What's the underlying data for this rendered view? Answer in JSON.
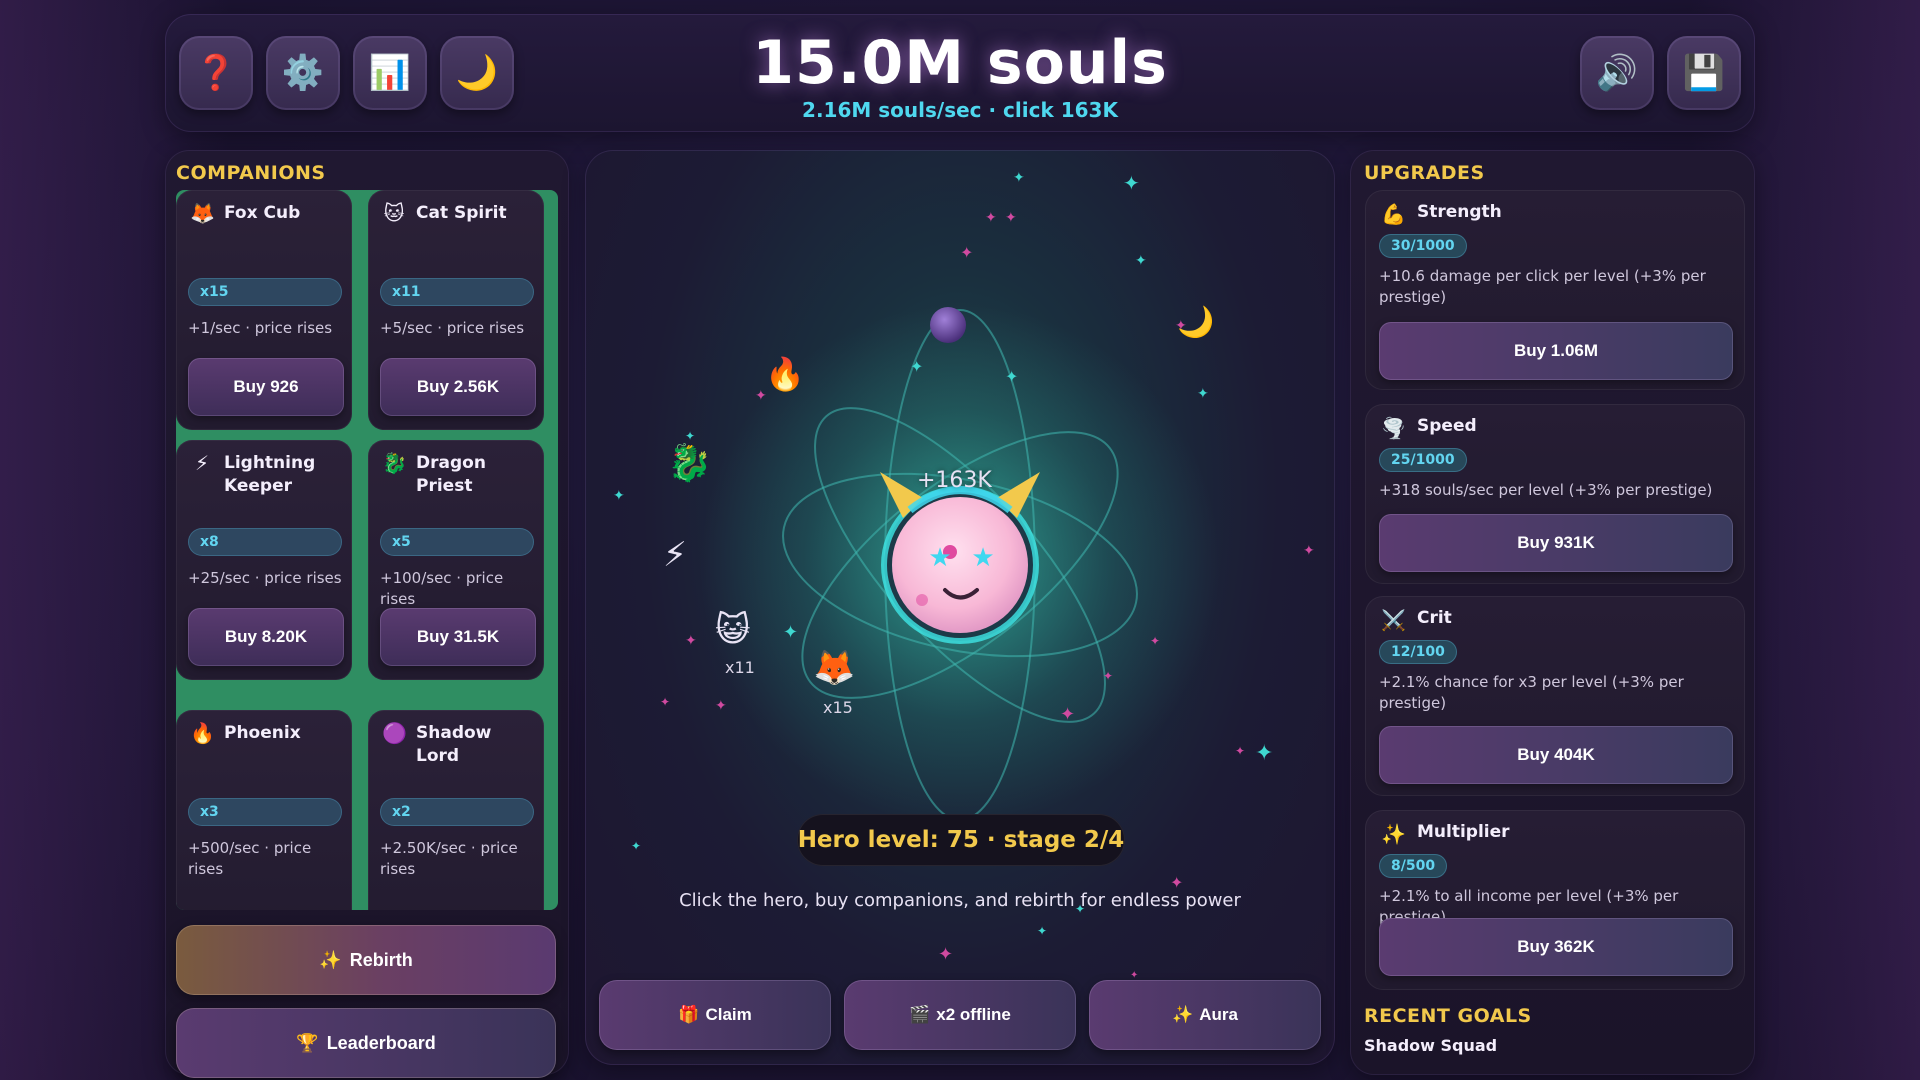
{
  "header": {
    "title": "15.0M souls",
    "subtitle": "2.16M souls/sec · click 163K",
    "buttons": {
      "help": "❓",
      "settings": "⚙️",
      "stats": "📊",
      "theme": "🌙",
      "sound": "🔊",
      "save": "💾"
    }
  },
  "companions": {
    "title": "COMPANIONS",
    "items": [
      {
        "icon": "🦊",
        "name": "Fox Cub",
        "count": "x15",
        "desc": "+1/sec · price rises",
        "buy": "Buy 926"
      },
      {
        "icon": "🐱",
        "name": "Cat Spirit",
        "count": "x11",
        "desc": "+5/sec · price rises",
        "buy": "Buy 2.56K"
      },
      {
        "icon": "⚡",
        "name": "Lightning Keeper",
        "count": "x8",
        "desc": "+25/sec · price rises",
        "buy": "Buy 8.20K"
      },
      {
        "icon": "🐉",
        "name": "Dragon Priest",
        "count": "x5",
        "desc": "+100/sec · price rises",
        "buy": "Buy 31.5K"
      },
      {
        "icon": "🔥",
        "name": "Phoenix",
        "count": "x3",
        "desc": "+500/sec · price rises",
        "buy": ""
      },
      {
        "icon": "🟣",
        "name": "Shadow Lord",
        "count": "x2",
        "desc": "+2.50K/sec · price rises",
        "buy": ""
      }
    ],
    "rebirth": {
      "icon": "✨",
      "label": "Rebirth"
    },
    "leaderboard": {
      "icon": "🏆",
      "label": "Leaderboard"
    }
  },
  "stage": {
    "click_popup": "+163K",
    "orbit_cat_label": "x11",
    "orbit_fox_label": "x15",
    "level_text": "Hero level: 75 · stage 2/4",
    "tagline": "Click the hero, buy companions, and rebirth for endless power",
    "actions": [
      {
        "icon": "🎁",
        "label": "Claim"
      },
      {
        "icon": "🎬",
        "label": "x2 offline"
      },
      {
        "icon": "✨",
        "label": "Aura"
      }
    ]
  },
  "upgrades": {
    "title": "UPGRADES",
    "items": [
      {
        "icon": "💪",
        "name": "Strength",
        "level": "30/1000",
        "desc": "+10.6 damage per click per level (+3% per prestige)",
        "buy": "Buy 1.06M"
      },
      {
        "icon": "🌪️",
        "name": "Speed",
        "level": "25/1000",
        "desc": "+318 souls/sec per level (+3% per prestige)",
        "buy": "Buy 931K"
      },
      {
        "icon": "⚔️",
        "name": "Crit",
        "level": "12/100",
        "desc": "+2.1% chance for x3 per level (+3% per prestige)",
        "buy": "Buy 404K"
      },
      {
        "icon": "✨",
        "name": "Multiplier",
        "level": "8/500",
        "desc": "+2.1% to all income per level (+3% per prestige)",
        "buy": "Buy 362K"
      }
    ]
  },
  "goals": {
    "title": "RECENT GOALS",
    "latest": "Shadow Squad"
  },
  "colors": {
    "accent_gold": "#f2c94c",
    "accent_cyan": "#4fd8ef",
    "companion_grid_bg": "#2f8e62"
  }
}
